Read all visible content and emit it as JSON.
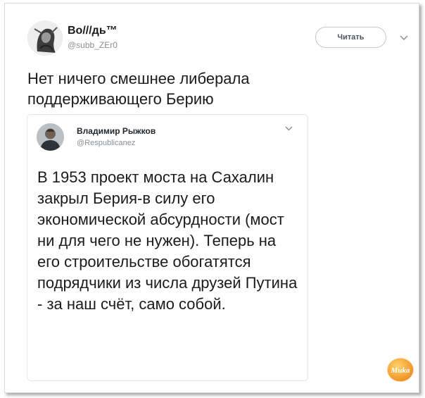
{
  "tweet": {
    "author_name": "Во///дь™",
    "author_handle": "@subb_ZEr0",
    "follow_label": "Читать",
    "text": "Нет ничего смешнее либерала поддерживающего Берию"
  },
  "quoted_tweet": {
    "author_name": "Владимир Рыжков",
    "author_handle": "@Respublicanez",
    "text": "В 1953 проект моста на Сахалин закрыл Берия-в силу его экономической абсурдности (мост ни для чего не нужен). Теперь на его строительстве обогатятся подрядчики из числа друзей Путина - за наш счёт, само собой."
  },
  "watermark": {
    "text": "Muka"
  },
  "colors": {
    "text": "#1b1b1b",
    "muted": "#8a8f94",
    "border": "#e1e8ed",
    "watermark": "#f5a623"
  },
  "icons": [
    "chevron-down-icon",
    "avatar",
    "watermark-logo"
  ]
}
